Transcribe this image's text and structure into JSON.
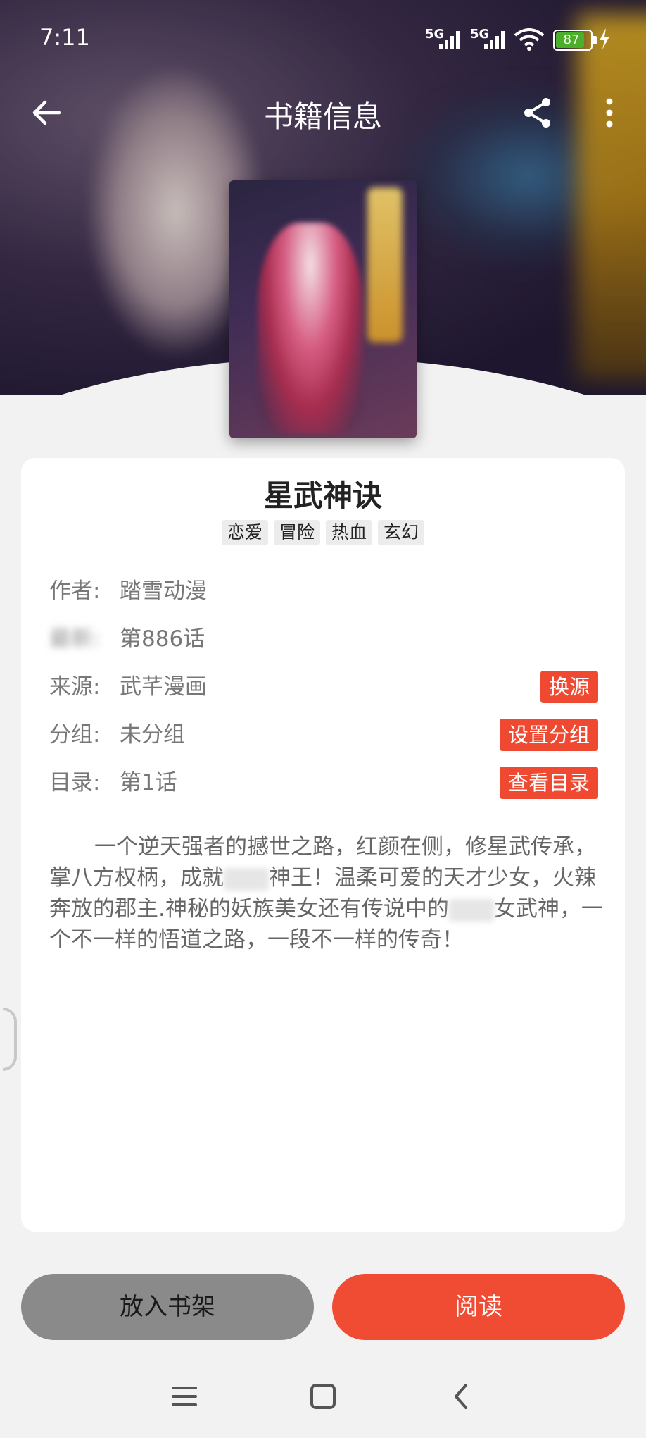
{
  "status_bar": {
    "time": "7:11",
    "signal1": "5G",
    "signal2": "5G",
    "battery": "87"
  },
  "nav": {
    "title": "书籍信息",
    "back_icon": "arrow-left-icon",
    "share_icon": "share-icon",
    "more_icon": "more-vertical-icon"
  },
  "book": {
    "title": "星武神诀",
    "tags": [
      "恋爱",
      "冒险",
      "热血",
      "玄幻"
    ],
    "author_label": "作者:",
    "author": "踏雪动漫",
    "latest_label": "最新:",
    "latest": "第886话",
    "source_label": "来源:",
    "source": "武芊漫画",
    "source_button": "换源",
    "group_label": "分组:",
    "group": "未分组",
    "group_button": "设置分组",
    "toc_label": "目录:",
    "toc": "第1话",
    "toc_button": "查看目录",
    "description_part1": "一个逆天强者的撼世之路，红颜在侧，修星武传承，掌八方权柄，成就",
    "description_part2": "神王！温柔可爱的天才少女，火辣奔放的郡主.神秘的妖族美女还有传说中的",
    "description_part3": "女武神，一个不一样的悟道之路，一段不一样的传奇！"
  },
  "actions": {
    "add_to_shelf": "放入书架",
    "read": "阅读"
  },
  "colors": {
    "accent": "#ef4a31",
    "shelf_button": "#8a8a8a",
    "background": "#f2f2f2"
  }
}
